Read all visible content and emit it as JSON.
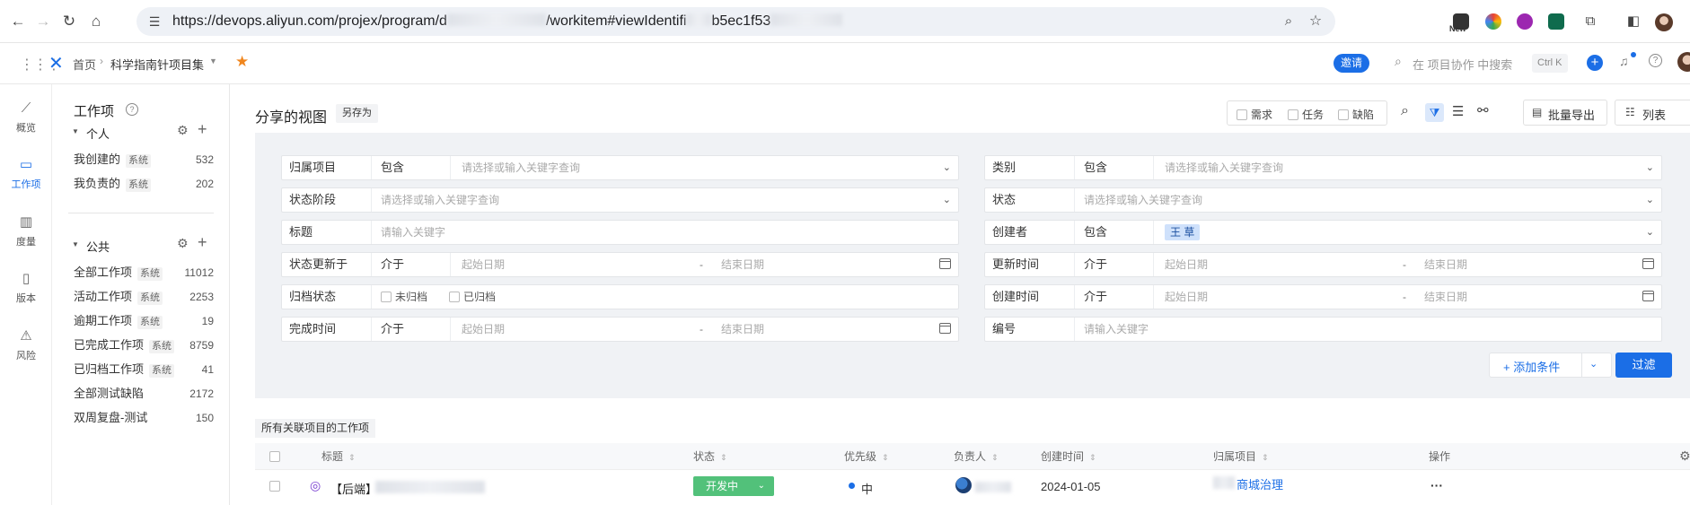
{
  "browser": {
    "url": "https://devops.aliyun.com/projex/program/d",
    "url_tail": "/workitem#viewIdentifi",
    "url_tail2": "b5ec1f53",
    "new_badge": "New"
  },
  "header": {
    "home": "首页",
    "project_set": "科学指南针项目集",
    "invite": "邀请",
    "search_placeholder": "在 项目协作 中搜索",
    "shortcut": "Ctrl K"
  },
  "rail": {
    "items": [
      {
        "label": "概览",
        "icon": "chart-line-icon"
      },
      {
        "label": "工作项",
        "icon": "workitem-icon"
      },
      {
        "label": "度量",
        "icon": "bar-chart-icon"
      },
      {
        "label": "版本",
        "icon": "version-icon"
      },
      {
        "label": "风险",
        "icon": "warning-icon"
      }
    ]
  },
  "sidebar": {
    "title": "工作项",
    "personal": {
      "title": "个人",
      "items": [
        {
          "label": "我创建的",
          "tag": "系统",
          "count": "532"
        },
        {
          "label": "我负责的",
          "tag": "系统",
          "count": "202"
        }
      ]
    },
    "public": {
      "title": "公共",
      "items": [
        {
          "label": "全部工作项",
          "tag": "系统",
          "count": "11012"
        },
        {
          "label": "活动工作项",
          "tag": "系统",
          "count": "2253"
        },
        {
          "label": "逾期工作项",
          "tag": "系统",
          "count": "19"
        },
        {
          "label": "已完成工作项",
          "tag": "系统",
          "count": "8759"
        },
        {
          "label": "已归档工作项",
          "tag": "系统",
          "count": "41"
        },
        {
          "label": "全部测试缺陷",
          "tag": "",
          "count": "2172"
        },
        {
          "label": "双周复盘-测试",
          "tag": "",
          "count": "150"
        }
      ]
    }
  },
  "view": {
    "title": "分享的视图",
    "save_as": "另存为",
    "type_filters": [
      "需求",
      "任务",
      "缺陷"
    ],
    "batch_export": "批量导出",
    "view_mode": "列表"
  },
  "filters": {
    "left": [
      {
        "label": "归属项目",
        "op": "包含",
        "placeholder": "请选择或输入关键字查询"
      },
      {
        "label": "状态阶段",
        "placeholder": "请选择或输入关键字查询"
      },
      {
        "label": "标题",
        "placeholder": "请输入关键字"
      },
      {
        "label": "状态更新于",
        "op": "介于",
        "start": "起始日期",
        "end": "结束日期"
      },
      {
        "label": "归档状态",
        "opt1": "未归档",
        "opt2": "已归档"
      },
      {
        "label": "完成时间",
        "op": "介于",
        "start": "起始日期",
        "end": "结束日期"
      }
    ],
    "right": [
      {
        "label": "类别",
        "op": "包含",
        "placeholder": "请选择或输入关键字查询"
      },
      {
        "label": "状态",
        "placeholder": "请选择或输入关键字查询"
      },
      {
        "label": "创建者",
        "op": "包含",
        "value": "王 草"
      },
      {
        "label": "更新时间",
        "op": "介于",
        "start": "起始日期",
        "end": "结束日期"
      },
      {
        "label": "创建时间",
        "op": "介于",
        "start": "起始日期",
        "end": "结束日期"
      },
      {
        "label": "编号",
        "placeholder": "请输入关键字"
      }
    ],
    "separator": "-",
    "add_condition": "添加条件",
    "apply": "过滤"
  },
  "table": {
    "section_title": "所有关联项目的工作项",
    "columns": [
      "标题",
      "状态",
      "优先级",
      "负责人",
      "创建时间",
      "归属项目",
      "操作"
    ],
    "rows": [
      {
        "title": "【后端】",
        "status": "开发中",
        "priority": "中",
        "created": "2024-01-05",
        "project": "商城治理",
        "action": "···"
      }
    ]
  },
  "colors": {
    "accent": "#1b6ee6",
    "status_green": "#52c17a",
    "panel": "#f0f2f5"
  }
}
